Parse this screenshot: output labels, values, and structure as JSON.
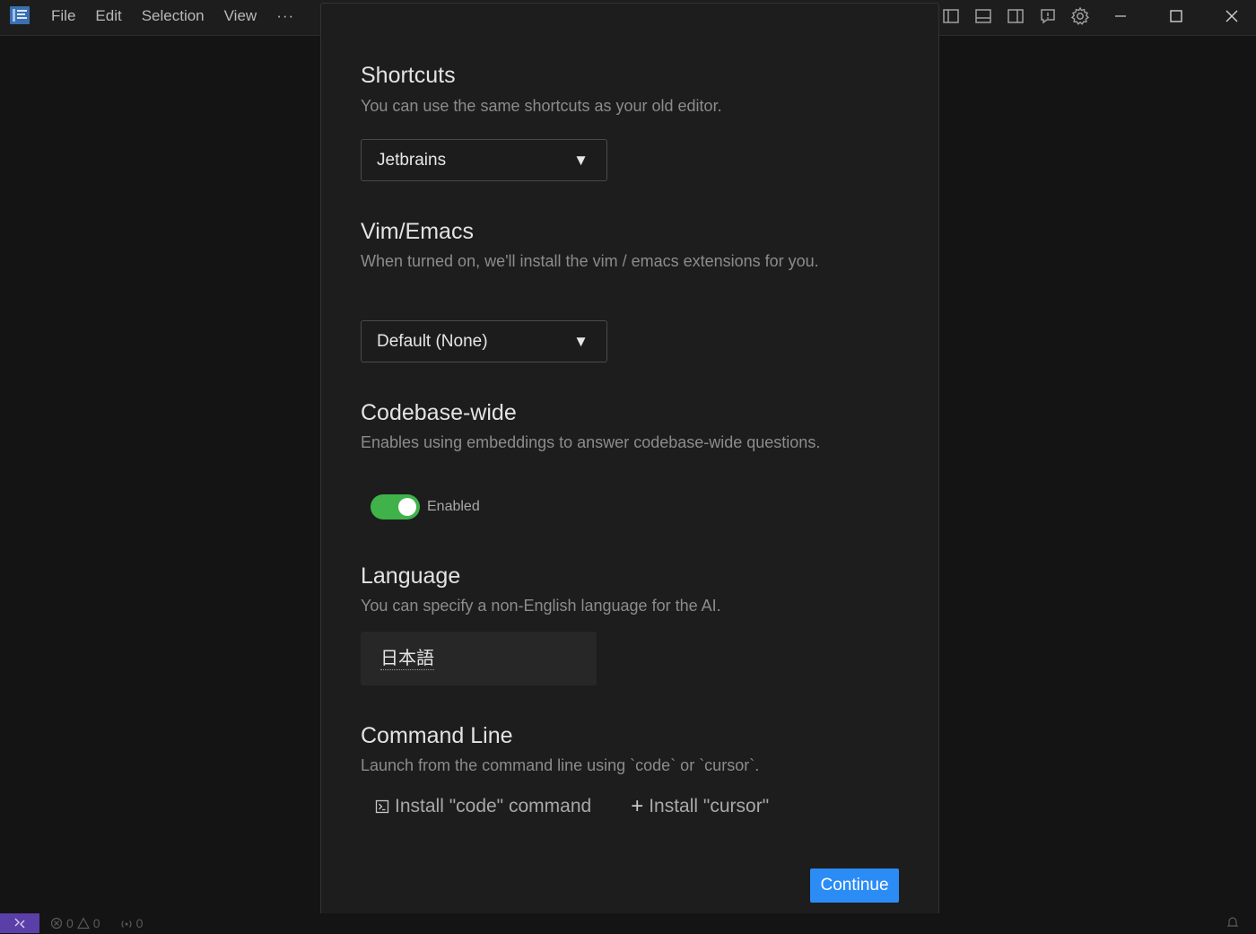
{
  "menu": {
    "items": [
      "File",
      "Edit",
      "Selection",
      "View"
    ],
    "more_label": "···"
  },
  "titlebar_icons": [
    "toggle-primary-sidebar-icon",
    "toggle-panel-icon",
    "toggle-secondary-sidebar-icon",
    "feedback-icon",
    "gear-icon"
  ],
  "window_controls": [
    "minimize-icon",
    "maximize-icon",
    "close-icon"
  ],
  "dialog": {
    "shortcuts": {
      "title": "Shortcuts",
      "description": "You can use the same shortcuts as your old editor.",
      "selected": "Jetbrains"
    },
    "vim": {
      "title": "Vim/Emacs",
      "description": "When turned on, we'll install the vim / emacs extensions for you.",
      "selected": "Default (None)"
    },
    "codebase": {
      "title": "Codebase-wide",
      "description": "Enables using embeddings to answer codebase-wide questions.",
      "toggle_label": "Enabled",
      "toggle_on": true
    },
    "language": {
      "title": "Language",
      "description": "You can specify a non-English language for the AI.",
      "value": "日本語"
    },
    "command_line": {
      "title": "Command Line",
      "description": "Launch from the command line using `code` or `cursor`.",
      "install_code": "Install \"code\" command",
      "install_cursor": "Install \"cursor\""
    },
    "continue_label": "Continue"
  },
  "statusbar": {
    "errors": "0",
    "warnings": "0",
    "ports": "0"
  },
  "colors": {
    "accent": "#2b8cf5",
    "toggle_on": "#3fb24a",
    "remote": "#5b3fa8"
  }
}
